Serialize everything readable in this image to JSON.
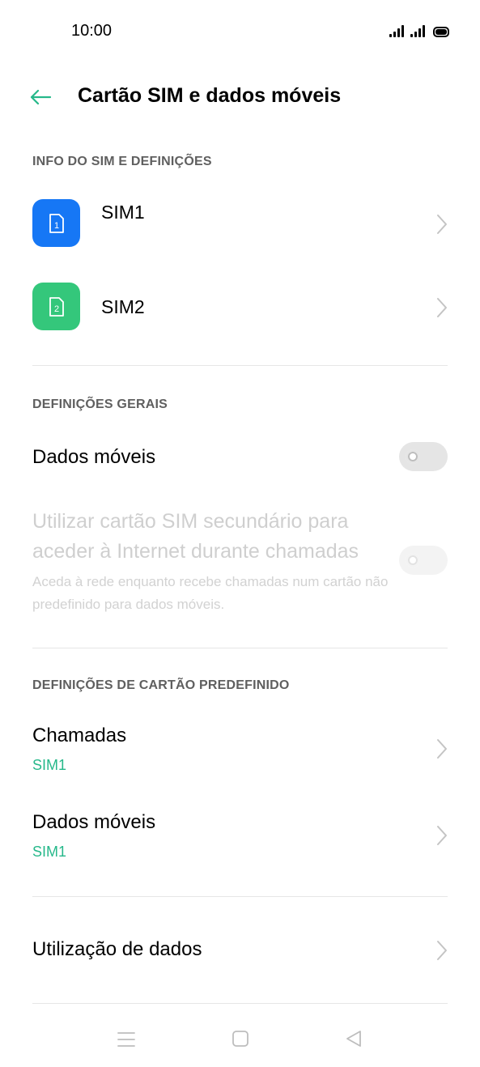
{
  "status_bar": {
    "time": "10:00"
  },
  "header": {
    "title": "Cartão SIM e dados móveis"
  },
  "sections": {
    "sim_info": {
      "header": "INFO DO SIM E DEFINIÇÕES",
      "sims": [
        {
          "label": "SIM1",
          "icon_number": "1",
          "color": "#1677f5"
        },
        {
          "label": "SIM2",
          "icon_number": "2",
          "color": "#34c77b"
        }
      ]
    },
    "general": {
      "header": "DEFINIÇÕES GERAIS",
      "mobile_data": {
        "label": "Dados móveis",
        "enabled": false
      },
      "secondary_sim": {
        "title": "Utilizar cartão SIM secundário para aceder à Internet durante chamadas",
        "description": "Aceda à rede enquanto recebe chamadas num cartão não predefinido para dados móveis.",
        "enabled": false,
        "disabled": true
      }
    },
    "default_card": {
      "header": "DEFINIÇÕES DE CARTÃO PREDEFINIDO",
      "calls": {
        "label": "Chamadas",
        "value": "SIM1"
      },
      "mobile_data": {
        "label": "Dados móveis",
        "value": "SIM1"
      }
    },
    "data_usage": {
      "label": "Utilização de dados"
    }
  },
  "colors": {
    "accent": "#26b88a",
    "sim1": "#1677f5",
    "sim2": "#34c77b"
  },
  "nav": {
    "icons": [
      "menu-icon",
      "home-icon",
      "back-icon"
    ]
  }
}
